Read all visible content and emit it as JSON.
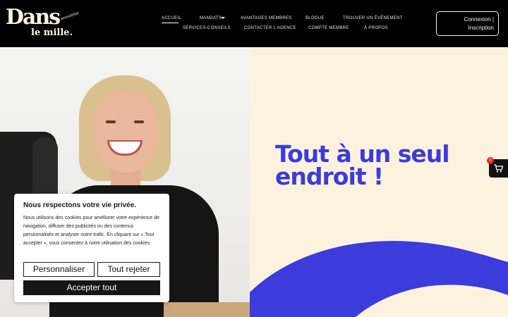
{
  "header": {
    "logo": {
      "main": "Dans",
      "sub": "le mille.",
      "tag": "Immobilier"
    },
    "nav": {
      "accueil": "Accueil",
      "mandats": "Mandats",
      "avantages": "Avantages membres",
      "blogue": "Blogue",
      "evenement": "Trouver un événement",
      "services": "Services-conseils",
      "contact": "Contacter l'agence",
      "compte": "Compte membre",
      "apropos": "À propos"
    },
    "login": {
      "line1": "Connexion |",
      "line2": "Inscription"
    }
  },
  "hero": {
    "headline_line1": "Tout à un seul",
    "headline_line2": "endroit !"
  },
  "cart": {
    "count": "0"
  },
  "cookie": {
    "title": "Nous respectons votre vie privée.",
    "body": "Nous utilisons des cookies pour améliorer votre expérience de navigation, diffuser des publicités ou des contenus personnalisés et analyser notre trafic. En cliquant sur « Tout accepter », vous consentez à notre utilisation des cookies.",
    "customize": "Personnaliser",
    "reject": "Tout rejeter",
    "accept": "Accepter tout"
  },
  "colors": {
    "accent_blue": "#3c3bdb",
    "cream": "#fdf2dd",
    "header_bg": "#000000",
    "badge_red": "#e4262b"
  }
}
